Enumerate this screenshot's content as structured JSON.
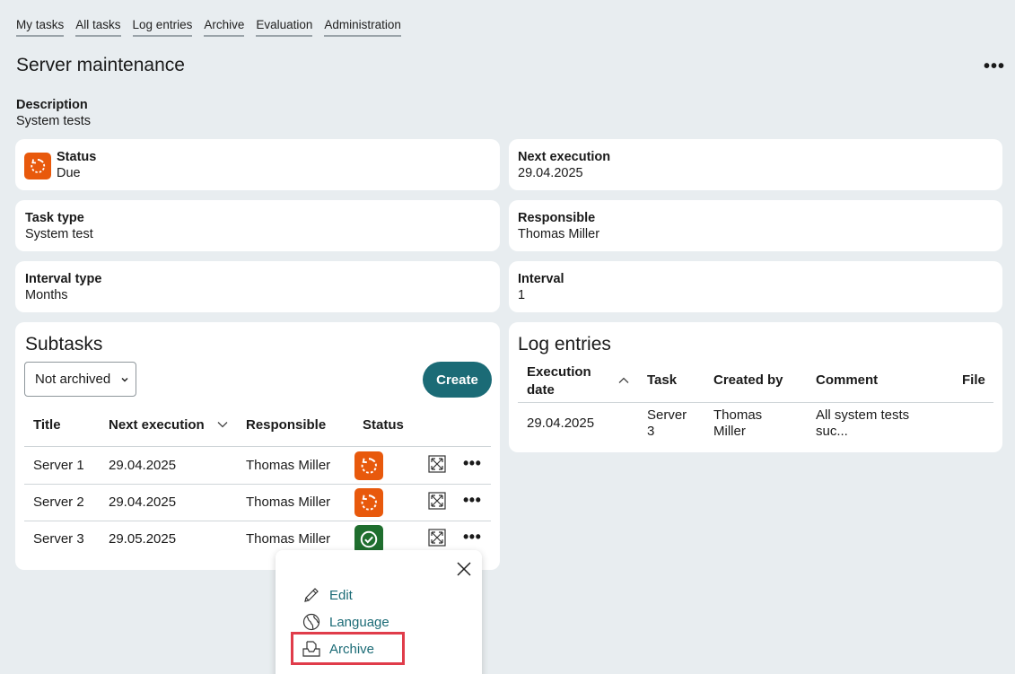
{
  "nav": [
    "My tasks",
    "All tasks",
    "Log entries",
    "Archive",
    "Evaluation",
    "Administration"
  ],
  "title": "Server maintenance",
  "more_label": "•••",
  "description": {
    "label": "Description",
    "value": "System tests"
  },
  "fields": {
    "status": {
      "label": "Status",
      "value": "Due"
    },
    "next_execution": {
      "label": "Next execution",
      "value": "29.04.2025"
    },
    "task_type": {
      "label": "Task type",
      "value": "System test"
    },
    "responsible": {
      "label": "Responsible",
      "value": "Thomas Miller"
    },
    "interval_type": {
      "label": "Interval type",
      "value": "Months"
    },
    "interval": {
      "label": "Interval",
      "value": "1"
    }
  },
  "subtasks": {
    "title": "Subtasks",
    "filter": "Not archived",
    "create_label": "Create",
    "columns": [
      "Title",
      "Next execution",
      "Responsible",
      "Status"
    ],
    "rows": [
      {
        "title": "Server 1",
        "next": "29.04.2025",
        "responsible": "Thomas Miller",
        "status": "due"
      },
      {
        "title": "Server 2",
        "next": "29.04.2025",
        "responsible": "Thomas Miller",
        "status": "due"
      },
      {
        "title": "Server 3",
        "next": "29.05.2025",
        "responsible": "Thomas Miller",
        "status": "done"
      }
    ]
  },
  "log": {
    "title": "Log entries",
    "columns": {
      "execution_date_1": "Execution",
      "execution_date_2": "date",
      "task": "Task",
      "created_by": "Created by",
      "comment": "Comment",
      "file": "File"
    },
    "rows": [
      {
        "date": "29.04.2025",
        "task_1": "Server",
        "task_2": "3",
        "created_1": "Thomas",
        "created_2": "Miller",
        "comment_1": "All system tests",
        "comment_2": "suc..."
      }
    ]
  },
  "menu": {
    "edit": "Edit",
    "language": "Language",
    "archive": "Archive"
  },
  "colors": {
    "due": "#e8590c",
    "done": "#1f6e2e",
    "accent": "#1b6b76",
    "highlight": "#e03c4a"
  }
}
